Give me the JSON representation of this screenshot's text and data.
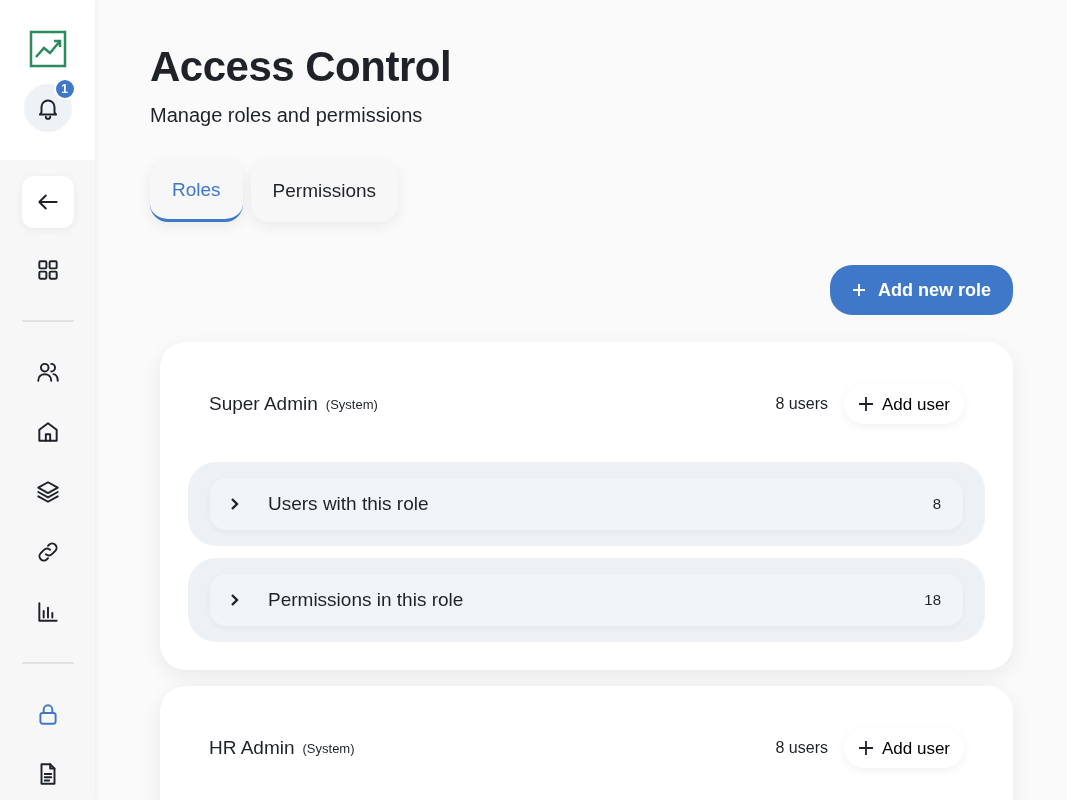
{
  "sidebar": {
    "notifications": {
      "count": "1"
    },
    "items": [
      {
        "selected": false
      },
      {
        "selected": false
      },
      {
        "selected": false
      },
      {
        "selected": false
      },
      {
        "selected": false
      },
      {
        "selected": false
      },
      {
        "selected": true
      },
      {
        "selected": false
      }
    ]
  },
  "header": {
    "title": "Access Control",
    "subtitle": "Manage roles and permissions"
  },
  "tabs": [
    {
      "label": "Roles",
      "selected": true
    },
    {
      "label": "Permissions",
      "selected": false
    }
  ],
  "add_role_button": {
    "label": "Add new role"
  },
  "roles": [
    {
      "name": "Super Admin",
      "tag": "(System)",
      "users": "8 users",
      "add_label": "Add user",
      "sections": [
        {
          "label": "Users with this role",
          "count": "8",
          "expanded": false
        },
        {
          "label": "Permissions in this role",
          "count": "18",
          "expanded": false
        }
      ]
    },
    {
      "name": "HR Admin",
      "tag": "(System)",
      "users": "8 users",
      "add_label": "Add user"
    }
  ]
}
